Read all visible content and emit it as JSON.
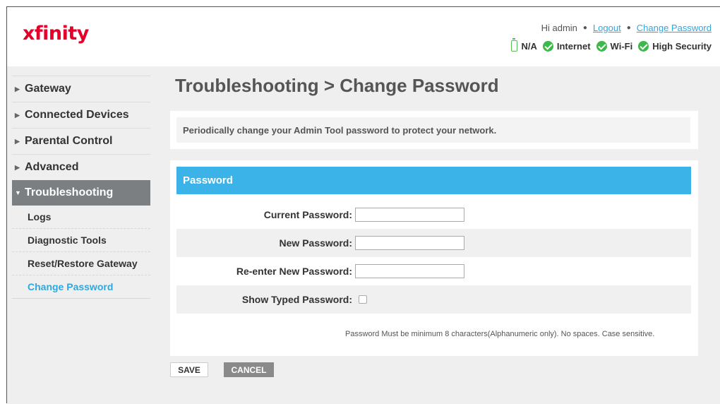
{
  "header": {
    "logo": "xfinity",
    "greeting": "Hi admin",
    "logout": "Logout",
    "change_password": "Change Password",
    "status": {
      "battery": "N/A",
      "internet": "Internet",
      "wifi": "Wi-Fi",
      "security": "High Security"
    },
    "status_color": "#3cb94a"
  },
  "sidebar": {
    "items": [
      {
        "label": "Gateway"
      },
      {
        "label": "Connected Devices"
      },
      {
        "label": "Parental Control"
      },
      {
        "label": "Advanced"
      },
      {
        "label": "Troubleshooting"
      }
    ],
    "sub_items": [
      {
        "label": "Logs"
      },
      {
        "label": "Diagnostic Tools"
      },
      {
        "label": "Reset/Restore Gateway"
      },
      {
        "label": "Change Password"
      }
    ]
  },
  "main": {
    "title": "Troubleshooting > Change Password",
    "info": "Periodically change your Admin Tool password to protect your network.",
    "form": {
      "header": "Password",
      "current_label": "Current Password:",
      "new_label": "New Password:",
      "reenter_label": "Re-enter New Password:",
      "show_label": "Show Typed Password:",
      "current_value": "",
      "new_value": "",
      "reenter_value": "",
      "show_checked": false,
      "hint": "Password Must be minimum 8 characters(Alphanumeric only). No spaces. Case sensitive."
    },
    "buttons": {
      "save": "SAVE",
      "cancel": "CANCEL"
    }
  },
  "colors": {
    "brand": "#e4002b",
    "accent": "#3bb2e8",
    "link": "#2fa7e0",
    "active_nav": "#7c7f82"
  }
}
